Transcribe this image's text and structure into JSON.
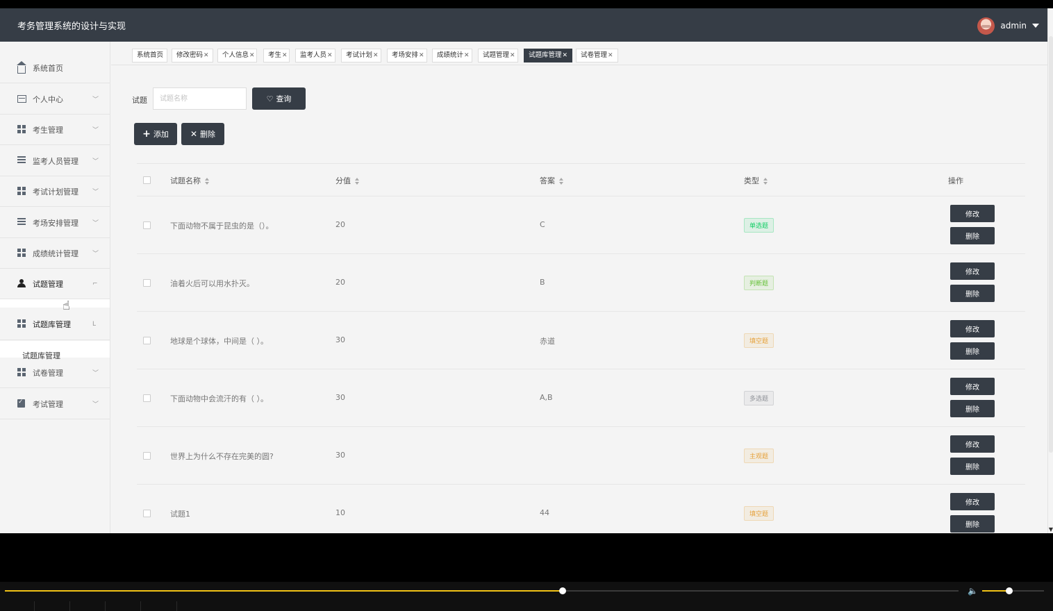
{
  "app": {
    "title": "考务管理系统的设计与实现",
    "username": "admin"
  },
  "sidebar": {
    "items": [
      {
        "label": "系统首页",
        "icon": "home-icon"
      },
      {
        "label": "个人中心",
        "icon": "card-icon"
      },
      {
        "label": "考生管理",
        "icon": "grid-icon"
      },
      {
        "label": "监考人员管理",
        "icon": "list-icon"
      },
      {
        "label": "考试计划管理",
        "icon": "grid-icon"
      },
      {
        "label": "考场安排管理",
        "icon": "list-icon"
      },
      {
        "label": "成绩统计管理",
        "icon": "grid-icon"
      },
      {
        "label": "试题管理",
        "icon": "person-icon"
      },
      {
        "label": "试题库管理",
        "icon": "grid-icon"
      },
      {
        "label": "试卷管理",
        "icon": "grid-icon"
      },
      {
        "label": "考试管理",
        "icon": "clipboard-icon"
      }
    ],
    "submenu_label": "试题库管理"
  },
  "tabs": [
    {
      "label": "系统首页",
      "closable": false
    },
    {
      "label": "修改密码",
      "closable": true
    },
    {
      "label": "个人信息",
      "closable": true
    },
    {
      "label": "考生",
      "closable": true
    },
    {
      "label": "监考人员",
      "closable": true
    },
    {
      "label": "考试计划",
      "closable": true
    },
    {
      "label": "考场安排",
      "closable": true
    },
    {
      "label": "成绩统计",
      "closable": true
    },
    {
      "label": "试题管理",
      "closable": true
    },
    {
      "label": "试题库管理",
      "closable": true,
      "active": true
    },
    {
      "label": "试卷管理",
      "closable": true
    }
  ],
  "search": {
    "label": "试题",
    "placeholder": "试题名称",
    "button_label": "查询"
  },
  "toolbar": {
    "add_label": "添加",
    "delete_label": "删除"
  },
  "table": {
    "headers": {
      "name": "试题名称",
      "score": "分值",
      "answer": "答案",
      "type": "类型",
      "ops": "操作"
    },
    "edit_label": "修改",
    "delete_label": "删除",
    "rows": [
      {
        "name": "下面动物不属于昆虫的是（）。",
        "score": "20",
        "answer": "C",
        "type": "单选题",
        "type_color": "#13ce66"
      },
      {
        "name": "油着火后可以用水扑灭。",
        "score": "20",
        "answer": "B",
        "type": "判断题",
        "type_color": "#67c23a"
      },
      {
        "name": "地球是个球体，中间是（ ）。",
        "score": "30",
        "answer": "赤道",
        "type": "填空题",
        "type_color": "#e6a23c"
      },
      {
        "name": "下面动物中会流汗的有（ ）。",
        "score": "30",
        "answer": "A,B",
        "type": "多选题",
        "type_color": "#909399"
      },
      {
        "name": "世界上为什么不存在完美的圆?",
        "score": "30",
        "answer": "",
        "type": "主观题",
        "type_color": "#e6a23c"
      },
      {
        "name": "试题1",
        "score": "10",
        "answer": "44",
        "type": "填空题",
        "type_color": "#e6a23c"
      }
    ]
  },
  "player": {
    "progress": 0.53,
    "volume": 0.44,
    "accent": "#f2c316"
  }
}
